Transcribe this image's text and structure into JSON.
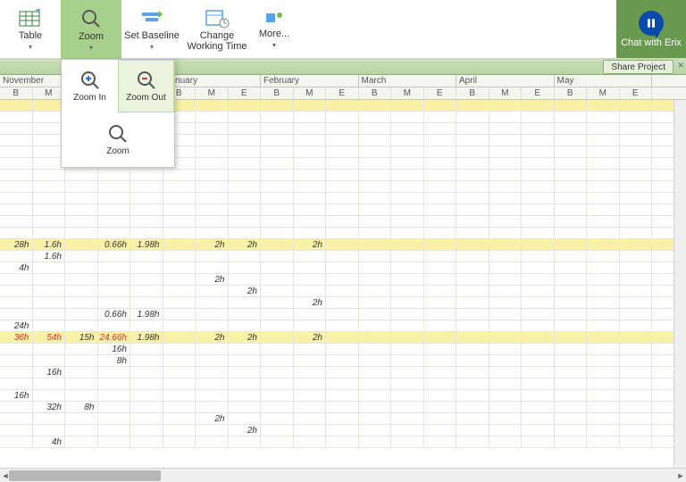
{
  "ribbon": {
    "table": "Table",
    "zoom": "Zoom",
    "set_baseline": "Set Baseline",
    "change_working_time": "Change\nWorking Time",
    "more": "More..."
  },
  "chat": {
    "label": "Chat with Erix"
  },
  "share": {
    "label": "Share Project"
  },
  "zoom_menu": {
    "zoom_in": "Zoom In",
    "zoom_out": "Zoom Out",
    "zoom": "Zoom"
  },
  "months": [
    "November",
    "",
    "January",
    "February",
    "March",
    "April",
    "May"
  ],
  "sub_labels": [
    "B",
    "M",
    "E"
  ],
  "colWidths": {
    "sub": 36.5,
    "monthSubs": [
      2,
      3,
      3,
      3,
      3,
      3,
      3
    ]
  },
  "rows": [
    {
      "hl": true,
      "cells": {}
    },
    {
      "cells": {}
    },
    {
      "cells": {}
    },
    {
      "cells": {}
    },
    {
      "cells": {}
    },
    {
      "cells": {}
    },
    {
      "cells": {}
    },
    {
      "cells": {}
    },
    {
      "cells": {}
    },
    {
      "cells": {}
    },
    {
      "cells": {}
    },
    {
      "cells": {}
    },
    {
      "hl": true,
      "cells": {
        "0": "28h",
        "1": "1.6h",
        "3": "0.66h",
        "4": "1.98h",
        "6": "2h",
        "7": "2h",
        "9": "2h"
      }
    },
    {
      "cells": {
        "1": "1.6h"
      }
    },
    {
      "cells": {
        "0": "4h"
      }
    },
    {
      "cells": {
        "6": "2h"
      }
    },
    {
      "cells": {
        "7": "2h"
      }
    },
    {
      "cells": {
        "9": "2h"
      }
    },
    {
      "cells": {
        "3": "0.66h",
        "4": "1.98h"
      }
    },
    {
      "cells": {
        "0": "24h"
      }
    },
    {
      "hl": true,
      "cells": {
        "0": {
          "v": "36h",
          "red": true
        },
        "1": {
          "v": "54h",
          "red": true
        },
        "2": "15h",
        "3": {
          "v": "24.66h",
          "red": true
        },
        "4": "1.98h",
        "6": "2h",
        "7": "2h",
        "9": "2h"
      }
    },
    {
      "cells": {
        "3": "16h"
      }
    },
    {
      "cells": {
        "3": "8h"
      }
    },
    {
      "cells": {
        "1": "16h"
      }
    },
    {
      "cells": {}
    },
    {
      "cells": {
        "0": "16h"
      }
    },
    {
      "cells": {
        "1": "32h",
        "2": "8h"
      }
    },
    {
      "cells": {
        "6": "2h"
      }
    },
    {
      "cells": {
        "7": "2h"
      }
    },
    {
      "cells": {
        "1": "4h"
      }
    }
  ]
}
